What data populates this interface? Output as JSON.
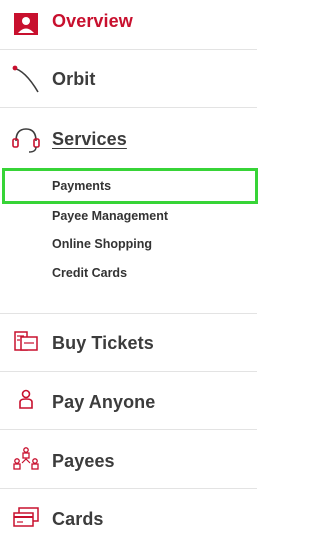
{
  "nav": {
    "overview": {
      "label": "Overview",
      "icon": "person-badge-icon"
    },
    "orbit": {
      "label": "Orbit",
      "icon": "orbit-arc-icon"
    },
    "services": {
      "label": "Services",
      "icon": "headset-icon",
      "sub_items": [
        {
          "label": "Payments",
          "active": true
        },
        {
          "label": "Payee Management"
        },
        {
          "label": "Online Shopping"
        },
        {
          "label": "Credit Cards"
        }
      ]
    },
    "buy_tickets": {
      "label": "Buy Tickets",
      "icon": "tickets-icon"
    },
    "pay_anyone": {
      "label": "Pay Anyone",
      "icon": "person-outline-icon"
    },
    "payees": {
      "label": "Payees",
      "icon": "people-group-icon"
    },
    "cards": {
      "label": "Cards",
      "icon": "cards-icon"
    }
  },
  "colors": {
    "accent": "#c8102e",
    "text": "#3c3c3c",
    "highlight": "#37d437",
    "divider": "#e3e3e3"
  }
}
